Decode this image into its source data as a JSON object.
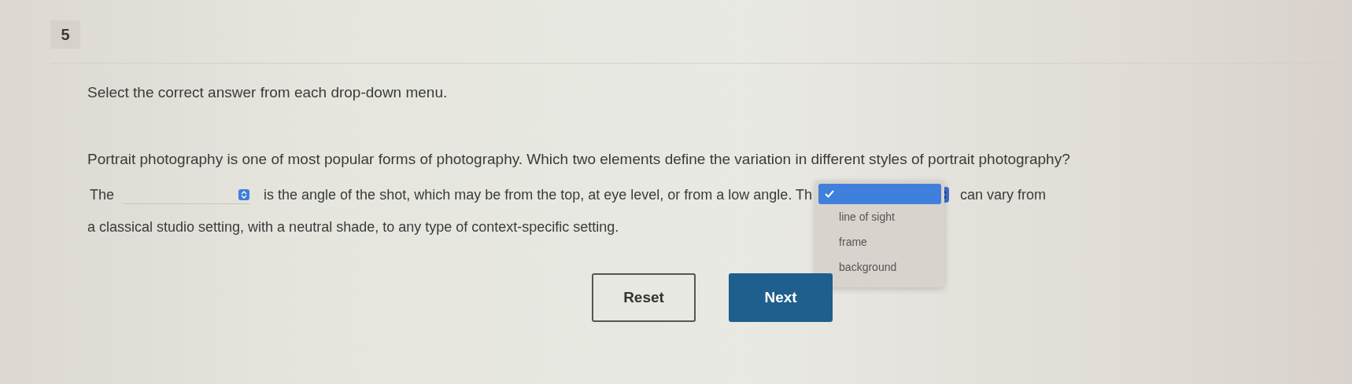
{
  "question_number": "5",
  "instruction": "Select the correct answer from each drop-down menu.",
  "question": "Portrait photography is one of most popular forms of photography. Which two elements define the variation in different styles of portrait photography?",
  "passage": {
    "line_1_start": "The",
    "dropdown_1": {
      "expanded": false
    },
    "line_1_middle": "is the angle of the shot, which may be from the top, at eye level, or from a low angle. Th",
    "dropdown_2": {
      "expanded": true,
      "blank_option_checked": true,
      "options": [
        {
          "label": "line of sight",
          "checked": false
        },
        {
          "label": "frame",
          "checked": false
        },
        {
          "label": "background",
          "checked": false
        }
      ]
    },
    "line_1_end": "can vary from",
    "line_2": "a classical studio setting, with a neutral shade, to any type of context-specific setting."
  },
  "buttons": [
    {
      "label": "Reset",
      "kind": "outline"
    },
    {
      "label": "Next",
      "kind": "primary"
    }
  ]
}
